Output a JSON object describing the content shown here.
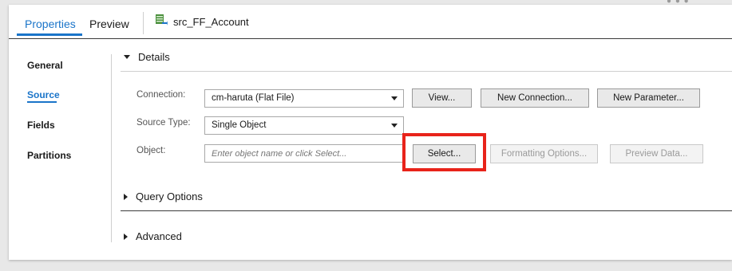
{
  "header": {
    "tabs": [
      {
        "label": "Properties",
        "active": true
      },
      {
        "label": "Preview",
        "active": false
      }
    ],
    "object_title": "src_FF_Account",
    "object_icon": "flat-file-source-icon",
    "more_icon": "more-dots-icon"
  },
  "nav": {
    "items": [
      {
        "label": "General",
        "active": false
      },
      {
        "label": "Source",
        "active": true
      },
      {
        "label": "Fields",
        "active": false
      },
      {
        "label": "Partitions",
        "active": false
      }
    ]
  },
  "sections": {
    "details": "Details",
    "query_options": "Query Options",
    "advanced": "Advanced"
  },
  "form": {
    "connection_label": "Connection:",
    "connection_value": "cm-haruta (Flat File)",
    "view_button": "View...",
    "new_connection_button": "New Connection...",
    "new_parameter_button": "New Parameter...",
    "source_type_label": "Source Type:",
    "source_type_value": "Single Object",
    "object_label": "Object:",
    "object_placeholder": "Enter object name or click Select...",
    "select_button": "Select...",
    "formatting_options_button": "Formatting Options...",
    "preview_data_button": "Preview Data..."
  },
  "colors": {
    "accent": "#1a74c9",
    "highlight": "#e8231a"
  }
}
